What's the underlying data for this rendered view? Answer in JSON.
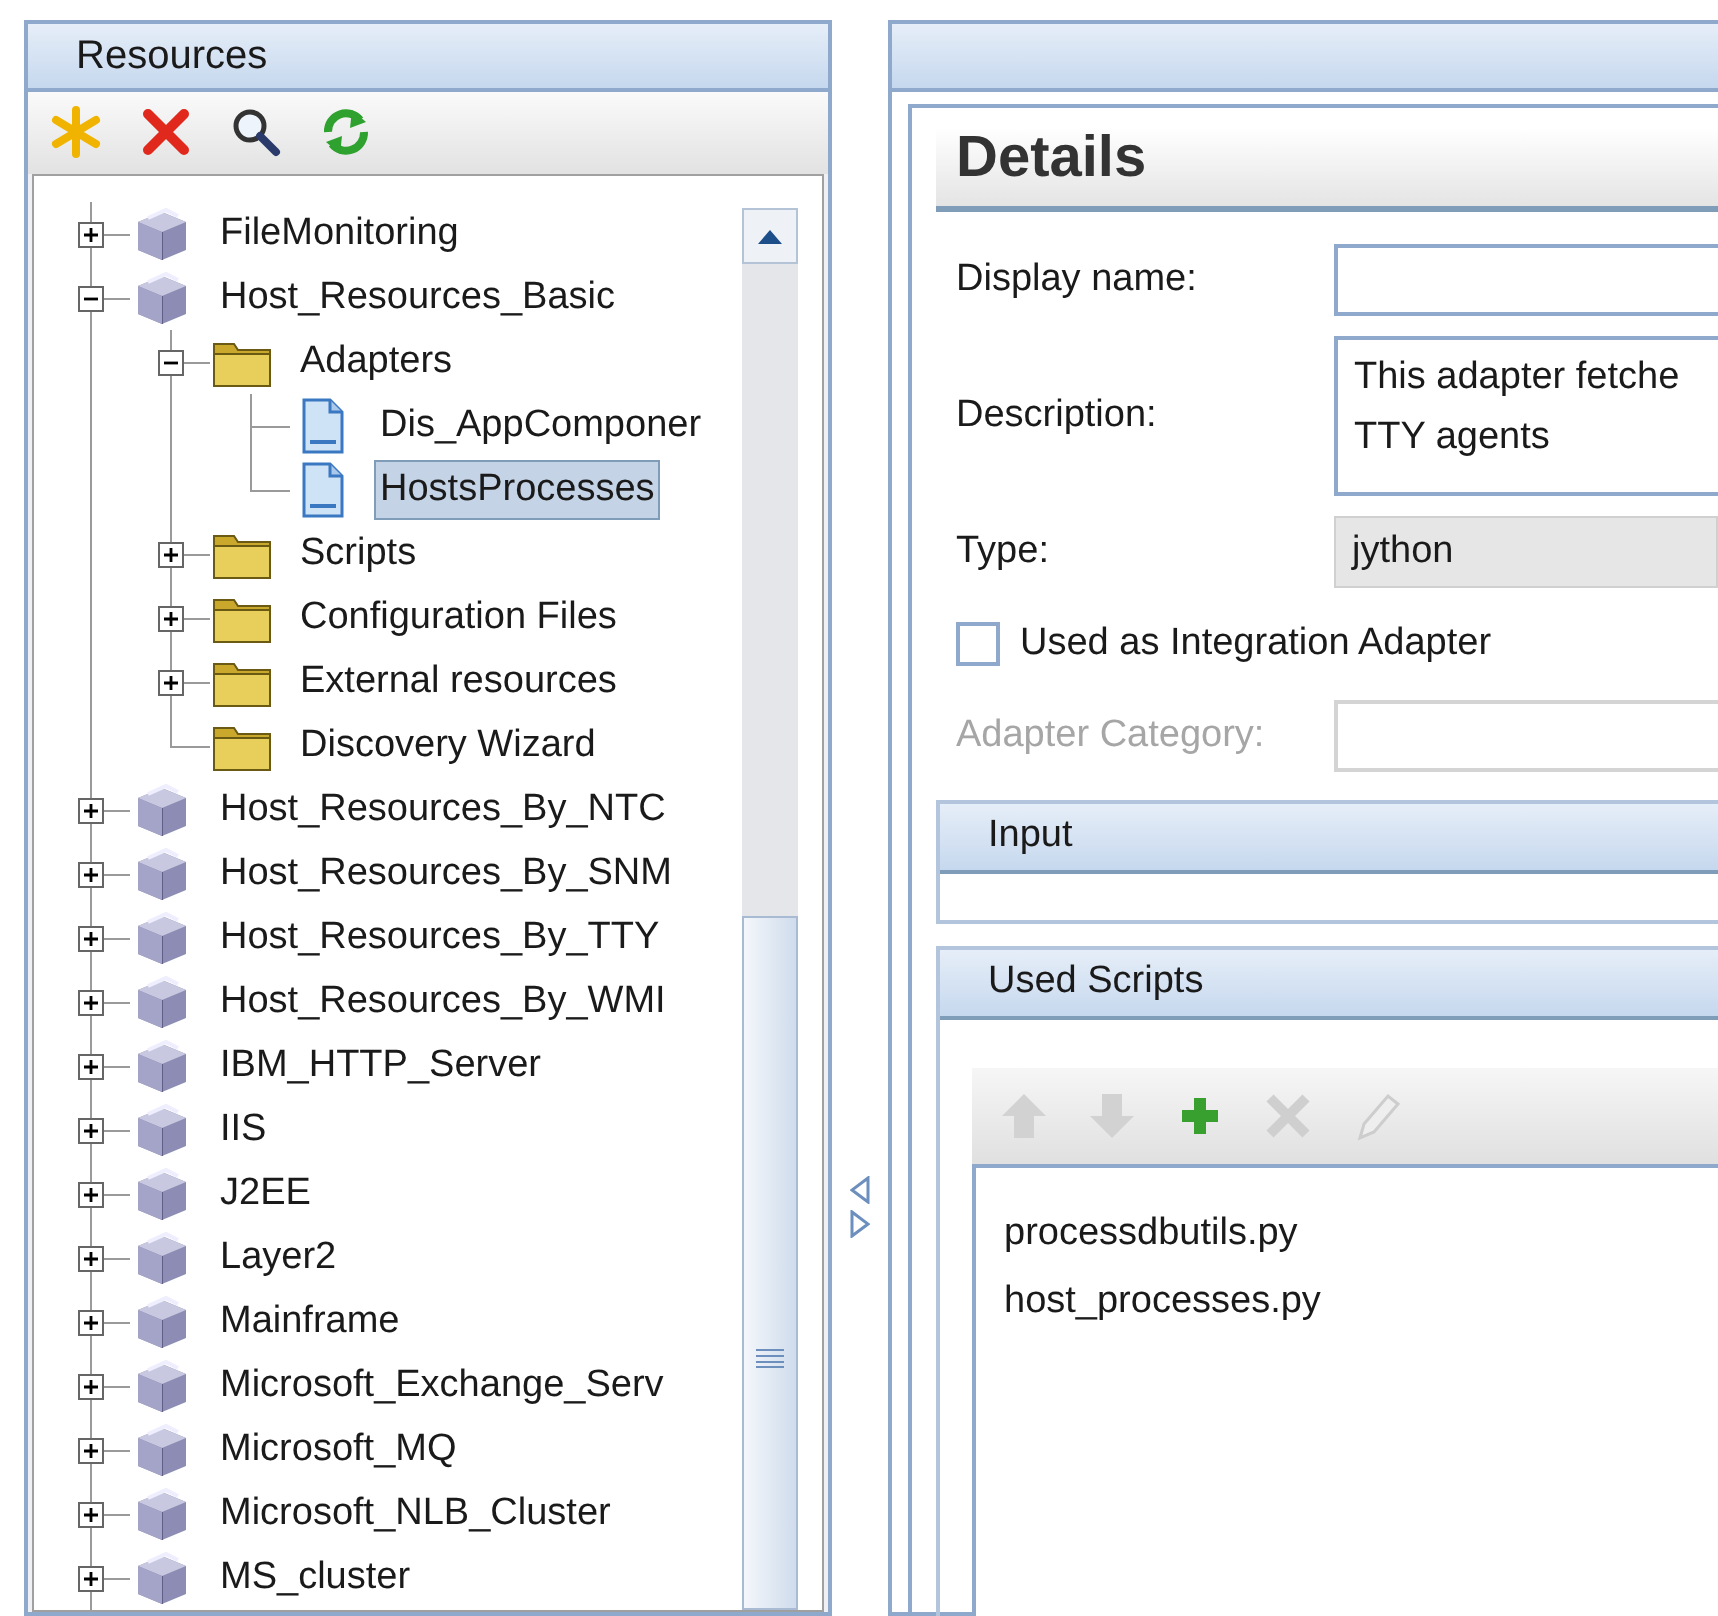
{
  "resources_panel": {
    "title": "Resources",
    "toolbar": [
      {
        "kind": "new"
      },
      {
        "kind": "delete"
      },
      {
        "kind": "search"
      },
      {
        "kind": "refresh"
      }
    ],
    "tree": [
      {
        "label": "FileMonitoring",
        "kind": "package",
        "expanded": false,
        "selected": false
      },
      {
        "label": "Host_Resources_Basic",
        "kind": "package",
        "expanded": true,
        "selected": false,
        "children": [
          {
            "label": "Adapters",
            "kind": "folder",
            "expanded": true,
            "selected": false,
            "children": [
              {
                "label": "Dis_AppComponer",
                "kind": "file",
                "selected": false
              },
              {
                "label": "HostsProcesses",
                "kind": "file",
                "selected": true
              }
            ]
          },
          {
            "label": "Scripts",
            "kind": "folder",
            "expanded": false,
            "selected": false
          },
          {
            "label": "Configuration Files",
            "kind": "folder",
            "expanded": false,
            "selected": false
          },
          {
            "label": "External resources",
            "kind": "folder",
            "expanded": false,
            "selected": false
          },
          {
            "label": "Discovery Wizard",
            "kind": "folder",
            "selected": false
          }
        ]
      },
      {
        "label": "Host_Resources_By_NTC",
        "kind": "package",
        "expanded": false,
        "selected": false
      },
      {
        "label": "Host_Resources_By_SNM",
        "kind": "package",
        "expanded": false,
        "selected": false
      },
      {
        "label": "Host_Resources_By_TTY",
        "kind": "package",
        "expanded": false,
        "selected": false
      },
      {
        "label": "Host_Resources_By_WMI",
        "kind": "package",
        "expanded": false,
        "selected": false
      },
      {
        "label": "IBM_HTTP_Server",
        "kind": "package",
        "expanded": false,
        "selected": false
      },
      {
        "label": "IIS",
        "kind": "package",
        "expanded": false,
        "selected": false
      },
      {
        "label": "J2EE",
        "kind": "package",
        "expanded": false,
        "selected": false
      },
      {
        "label": "Layer2",
        "kind": "package",
        "expanded": false,
        "selected": false
      },
      {
        "label": "Mainframe",
        "kind": "package",
        "expanded": false,
        "selected": false
      },
      {
        "label": "Microsoft_Exchange_Serv",
        "kind": "package",
        "expanded": false,
        "selected": false
      },
      {
        "label": "Microsoft_MQ",
        "kind": "package",
        "expanded": false,
        "selected": false
      },
      {
        "label": "Microsoft_NLB_Cluster",
        "kind": "package",
        "expanded": false,
        "selected": false
      },
      {
        "label": "MS_cluster",
        "kind": "package",
        "expanded": false,
        "selected": false
      }
    ]
  },
  "details_panel": {
    "title": "Details",
    "fields": [
      {
        "kind": "text",
        "label": "Display name:",
        "disabled": false
      },
      {
        "kind": "textarea",
        "label": "Description:",
        "lines": [
          "This adapter fetche",
          "TTY agents"
        ]
      },
      {
        "kind": "readonly",
        "label": "Type:",
        "value": "jython"
      },
      {
        "kind": "checkbox",
        "label": "Used as Integration Adapter",
        "checked": false
      },
      {
        "kind": "text",
        "label": "Adapter Category:",
        "disabled": true
      }
    ],
    "sections": [
      {
        "title": "Input"
      },
      {
        "title": "Used Scripts",
        "toolbar": [
          {
            "kind": "up",
            "disabled": true
          },
          {
            "kind": "down",
            "disabled": true
          },
          {
            "kind": "add",
            "disabled": false
          },
          {
            "kind": "remove",
            "disabled": true
          },
          {
            "kind": "edit",
            "disabled": true
          }
        ],
        "items": [
          "processdbutils.py",
          "host_processes.py"
        ]
      }
    ]
  }
}
